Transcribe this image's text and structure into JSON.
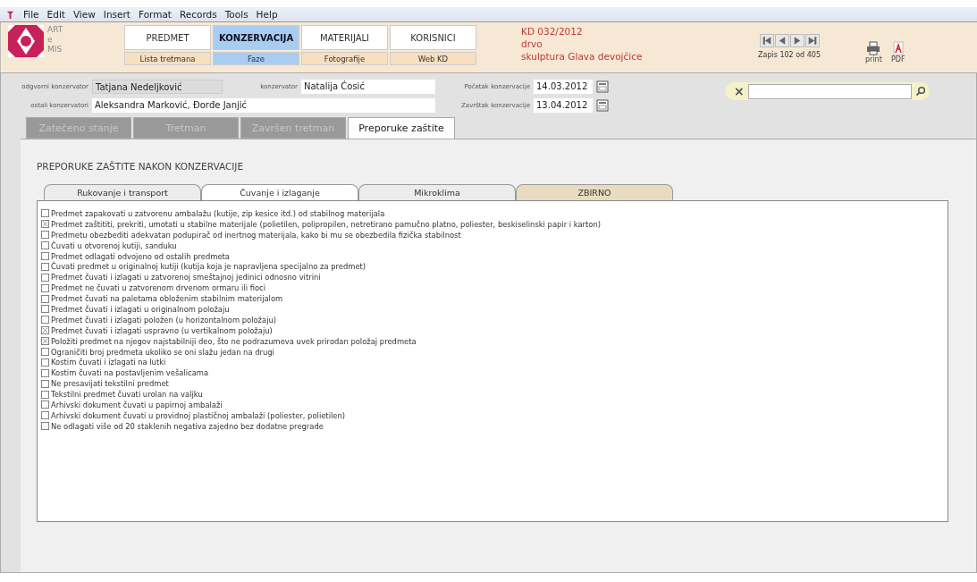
{
  "menu": [
    "File",
    "Edit",
    "View",
    "Insert",
    "Format",
    "Records",
    "Tools",
    "Help"
  ],
  "logo": {
    "lines": [
      "ART",
      "e",
      "MIS"
    ]
  },
  "nav": [
    {
      "label": "PREDMET",
      "selected": false,
      "sub": {
        "label": "Lista tretmana",
        "selected": false
      }
    },
    {
      "label": "KONZERVACIJA",
      "selected": true,
      "sub": {
        "label": "Faze",
        "selected": true
      }
    },
    {
      "label": "MATERIJALI",
      "selected": false,
      "sub": {
        "label": "Fotografije",
        "selected": false
      }
    },
    {
      "label": "KORISNICI",
      "selected": false,
      "sub": {
        "label": "Web KD",
        "selected": false
      }
    }
  ],
  "record_info": [
    "KD 032/2012",
    "drvo",
    "skulptura Glava devojčice"
  ],
  "record_nav": {
    "status": "Zapis 102 od 405"
  },
  "actions": [
    {
      "kind": "print",
      "label": "print"
    },
    {
      "kind": "pdf",
      "label": "PDF"
    }
  ],
  "fields": {
    "responsible": {
      "label": "odgvorni konzervator",
      "value": "Tatjana Nedeljković",
      "disabled": true
    },
    "conservator": {
      "label": "konzervator",
      "value": "Natalija Ćosić",
      "disabled": false
    },
    "others": {
      "label": "ostali konzervatori",
      "value": "Aleksandra Marković, Đorđe Janjić",
      "disabled": false
    },
    "start": {
      "label": "Početak konzervacije",
      "value": "14.03.2012"
    },
    "end": {
      "label": "Završtak konzervacije",
      "value": "13.04.2012"
    }
  },
  "search": {
    "clear": "×"
  },
  "tabs": [
    {
      "label": "Zatečeno stanje",
      "selected": false,
      "disabled": true
    },
    {
      "label": "Tretman",
      "selected": false,
      "disabled": true
    },
    {
      "label": "Završen tretman",
      "selected": false,
      "disabled": true
    },
    {
      "label": "Preporuke zaštite",
      "selected": true,
      "disabled": false
    }
  ],
  "section_title": "PREPORUKE ZAŠTITE NAKON KONZERVACIJE",
  "subtabs": [
    {
      "label": "Rukovanje i transport",
      "selected": false,
      "kind": "normal"
    },
    {
      "label": "Čuvanje i izlaganje",
      "selected": true,
      "kind": "normal"
    },
    {
      "label": "Mikroklima",
      "selected": false,
      "kind": "normal"
    },
    {
      "label": "ZBIRNO",
      "selected": false,
      "kind": "summary"
    }
  ],
  "checklist": [
    {
      "label": "Predmet zapakovati u zatvorenu ambalažu (kutije, zip kesice itd.) od stabilnog materijala",
      "checked": false
    },
    {
      "label": "Predmet zaštititi, prekriti, umotati u stabilne materijale (polietilen, polipropilen, netretirano pamučno platno, poliester, beskiselinski papir i karton)",
      "checked": true
    },
    {
      "label": "Predmetu obezbediti adekvatan podupirač od inertnog materijala, kako bi mu se obezbedila fizička stabilnost",
      "checked": false
    },
    {
      "label": "Čuvati u otvorenoj kutiji, sanduku",
      "checked": false
    },
    {
      "label": "Predmet odlagati odvojeno od ostalih predmeta",
      "checked": false
    },
    {
      "label": "Čuvati predmet u originalnoj kutiji (kutija koja je napravljena specijalno za predmet)",
      "checked": false
    },
    {
      "label": "Predmet čuvati i izlagati u zatvorenoj smeštajnoj jedinici odnosno vitrini",
      "checked": false
    },
    {
      "label": "Predmet ne čuvati u zatvorenom drvenom ormaru ili fioci",
      "checked": false
    },
    {
      "label": "Predmet čuvati na paletama obloženim stabilnim materijalom",
      "checked": false
    },
    {
      "label": "Predmet čuvati i izlagati u originalnom položaju",
      "checked": false
    },
    {
      "label": "Predmet čuvati i izlagati položen (u horizontalnom položaju)",
      "checked": false
    },
    {
      "label": "Predmet čuvati i izlagati uspravno (u vertikalnom položaju)",
      "checked": true
    },
    {
      "label": "Položiti predmet na njegov najstabilniji deo, što ne podrazumeva uvek prirodan položaj predmeta",
      "checked": true
    },
    {
      "label": "Ograničiti broj predmeta ukoliko se oni slažu jedan na drugi",
      "checked": false
    },
    {
      "label": "Kostim čuvati i izlagati na lutki",
      "checked": false
    },
    {
      "label": "Kostim čuvati na postavljenim vešalicama",
      "checked": false
    },
    {
      "label": "Ne presavijati tekstilni predmet",
      "checked": false
    },
    {
      "label": "Tekstilni predmet čuvati urolan na valjku",
      "checked": false
    },
    {
      "label": "Arhivski dokument čuvati u papirnoj ambalaži",
      "checked": false
    },
    {
      "label": "Arhivski dokument čuvati u providnoj plastičnoj ambalaži (poliester, polietilen)",
      "checked": false
    },
    {
      "label": "Ne odlagati više od 20 staklenih negativa zajedno bez dodatne pregrade",
      "checked": false
    }
  ]
}
